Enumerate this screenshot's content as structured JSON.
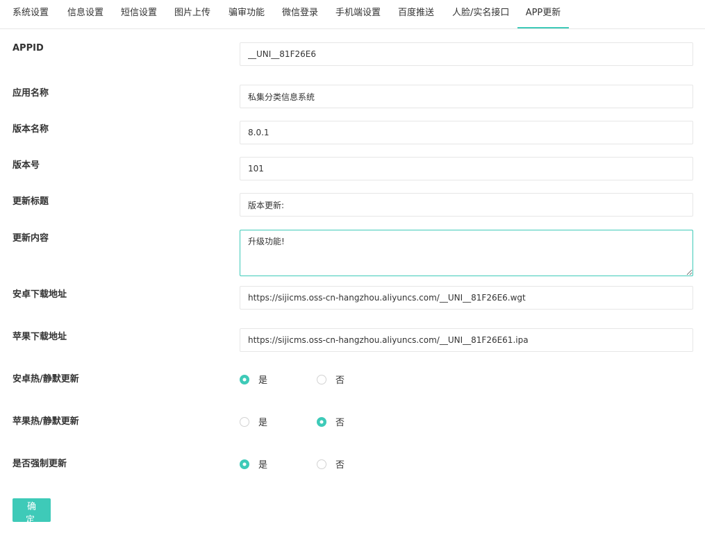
{
  "tabs": [
    {
      "label": "系统设置"
    },
    {
      "label": "信息设置"
    },
    {
      "label": "短信设置"
    },
    {
      "label": "图片上传"
    },
    {
      "label": "骗审功能"
    },
    {
      "label": "微信登录"
    },
    {
      "label": "手机端设置"
    },
    {
      "label": "百度推送"
    },
    {
      "label": "人脸/实名接口"
    },
    {
      "label": "APP更新"
    }
  ],
  "active_tab": "APP更新",
  "form": {
    "appid": {
      "label": "APPID",
      "value": "__UNI__81F26E6"
    },
    "app_name": {
      "label": "应用名称",
      "value": "私集分类信息系统"
    },
    "version_name": {
      "label": "版本名称",
      "value": "8.0.1"
    },
    "version_code": {
      "label": "版本号",
      "value": "101"
    },
    "update_title": {
      "label": "更新标题",
      "value": "版本更新:"
    },
    "update_content": {
      "label": "更新内容",
      "value": "升级功能!"
    },
    "android_url": {
      "label": "安卓下载地址",
      "value": "https://sijicms.oss-cn-hangzhou.aliyuncs.com/__UNI__81F26E6.wgt"
    },
    "ios_url": {
      "label": "苹果下载地址",
      "value": "https://sijicms.oss-cn-hangzhou.aliyuncs.com/__UNI__81F26E61.ipa"
    },
    "android_silent": {
      "label": "安卓热/静默更新",
      "yes": "是",
      "no": "否",
      "selected": "是"
    },
    "ios_silent": {
      "label": "苹果热/静默更新",
      "yes": "是",
      "no": "否",
      "selected": "否"
    },
    "force_update": {
      "label": "是否强制更新",
      "yes": "是",
      "no": "否",
      "selected": "是"
    }
  },
  "submit_label": "确 定",
  "colors": {
    "accent": "#3ecab8",
    "border": "#e6e6e6",
    "text": "#333333"
  }
}
